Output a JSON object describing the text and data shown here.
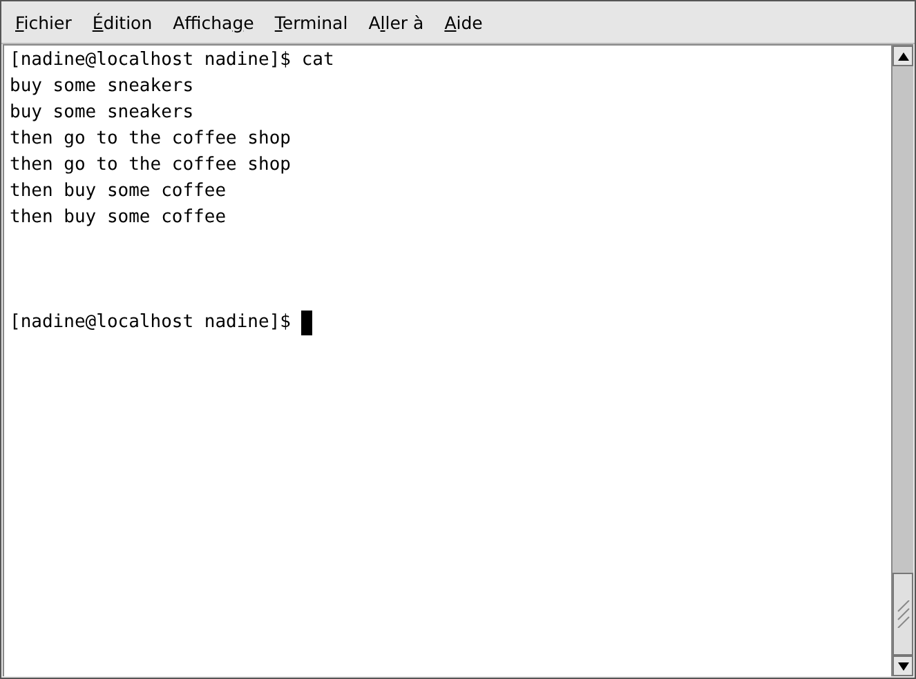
{
  "menu": [
    {
      "key": "F",
      "post": "ichier"
    },
    {
      "key": "É",
      "post": "dition"
    },
    {
      "pre": "Afficha",
      "key": "g",
      "post": "e"
    },
    {
      "key": "T",
      "post": "erminal"
    },
    {
      "pre": "A",
      "key": "l",
      "post": "ler à"
    },
    {
      "key": "A",
      "post": "ide"
    }
  ],
  "terminal": {
    "lines": [
      {
        "kind": "text",
        "text": "[nadine@localhost nadine]$ cat"
      },
      {
        "kind": "text",
        "text": "buy some sneakers"
      },
      {
        "kind": "text",
        "text": "buy some sneakers"
      },
      {
        "kind": "text",
        "text": "then go to the coffee shop"
      },
      {
        "kind": "text",
        "text": "then go to the coffee shop"
      },
      {
        "kind": "text",
        "text": "then buy some coffee"
      },
      {
        "kind": "text",
        "text": "then buy some coffee"
      },
      {
        "kind": "blank"
      },
      {
        "kind": "blank"
      },
      {
        "kind": "blank"
      },
      {
        "kind": "prompt",
        "text": "[nadine@localhost nadine]$ "
      }
    ]
  }
}
